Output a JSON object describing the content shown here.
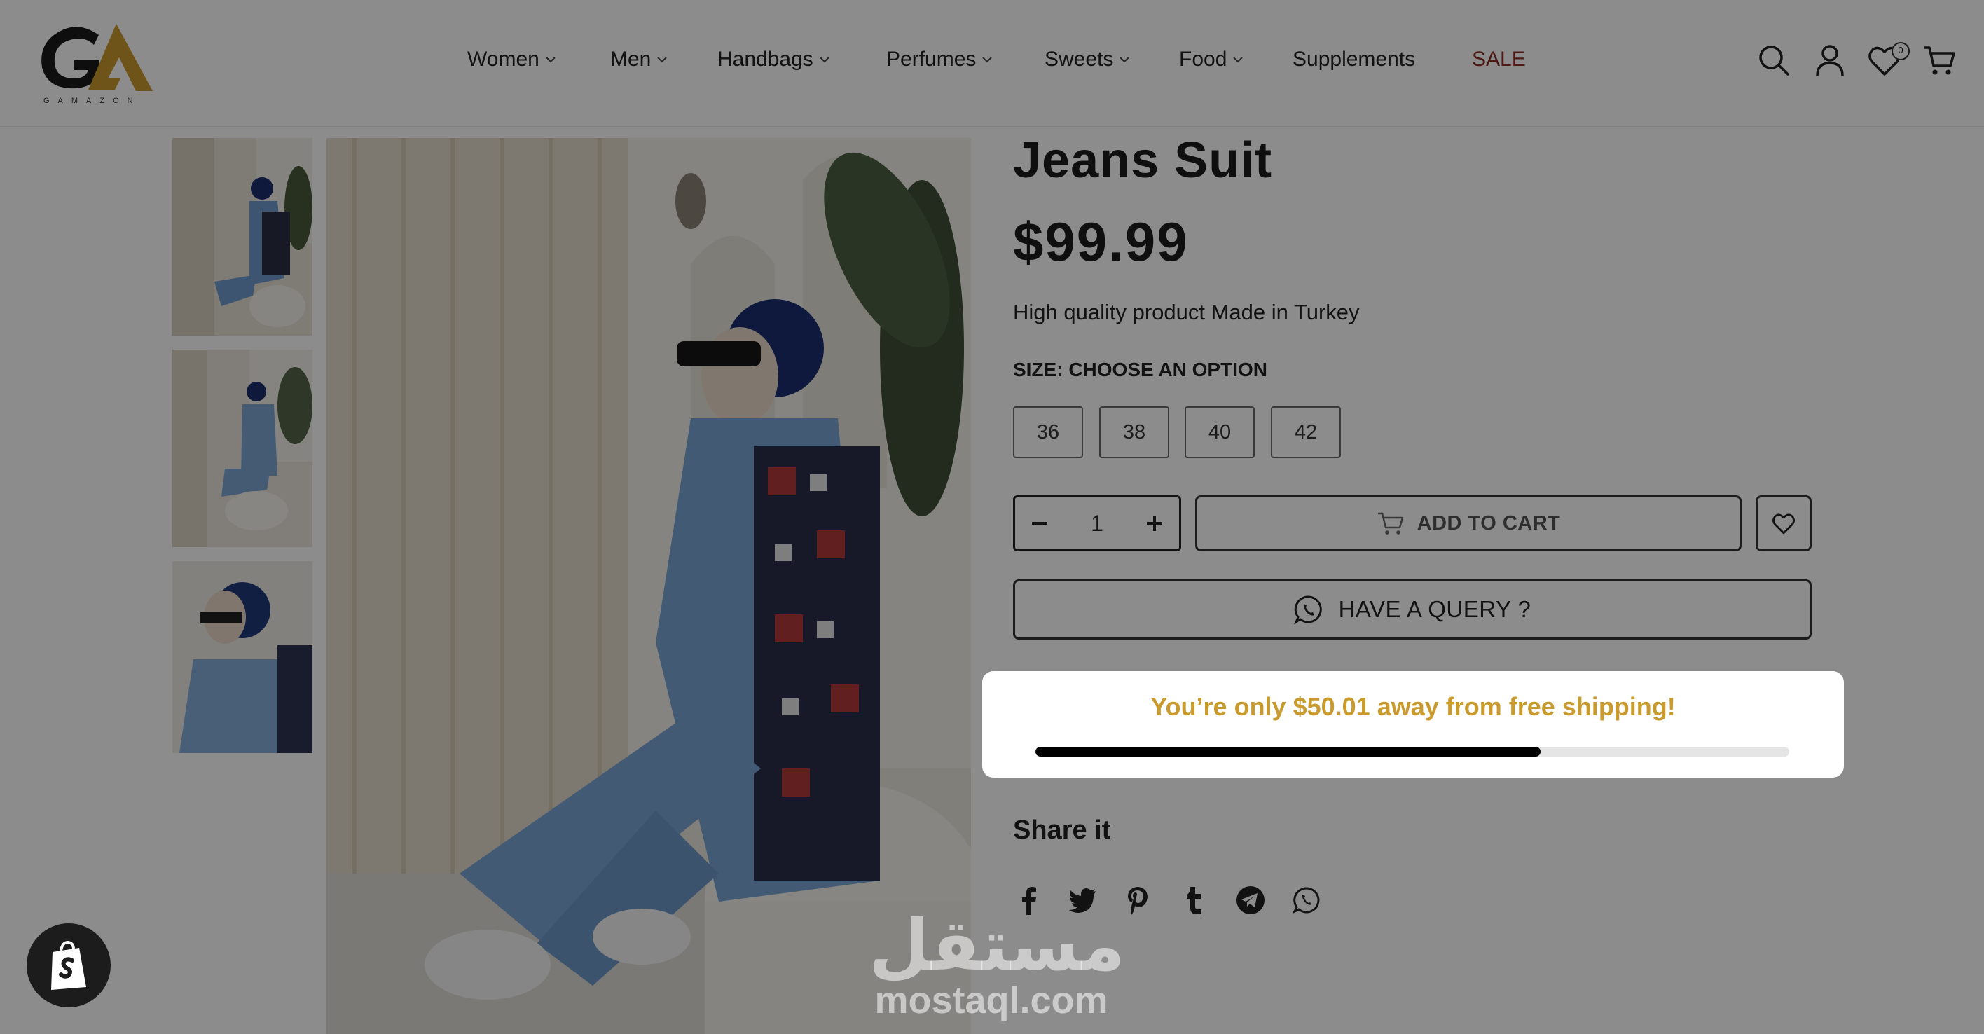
{
  "brand": {
    "name": "GA",
    "subtitle": "GAMAZON",
    "colors": {
      "dark": "#1a1a1a",
      "gold": "#c99a2e"
    }
  },
  "nav": {
    "items": [
      {
        "label": "Women",
        "dropdown": true
      },
      {
        "label": "Men",
        "dropdown": true
      },
      {
        "label": "Handbags",
        "dropdown": true
      },
      {
        "label": "Perfumes",
        "dropdown": true
      },
      {
        "label": "Sweets",
        "dropdown": true
      },
      {
        "label": "Food",
        "dropdown": true
      },
      {
        "label": "Supplements",
        "dropdown": false
      },
      {
        "label": "SALE",
        "dropdown": false
      }
    ],
    "sale_color": "#8b2e25"
  },
  "header_icons": {
    "search": "search-icon",
    "account": "user-icon",
    "wishlist": "heart-icon",
    "wishlist_count": "0",
    "cart": "cart-icon"
  },
  "product": {
    "title": "Jeans Suit",
    "price": "$99.99",
    "description": "High quality product Made in Turkey",
    "size_label": "SIZE: CHOOSE AN OPTION",
    "sizes": [
      "36",
      "38",
      "40",
      "42"
    ],
    "quantity": "1",
    "add_to_cart": "ADD TO CART",
    "query": "HAVE A QUERY ?"
  },
  "share": {
    "title": "Share it",
    "networks": [
      "facebook-icon",
      "twitter-icon",
      "pinterest-icon",
      "tumblr-icon",
      "telegram-icon",
      "whatsapp-icon"
    ]
  },
  "shipping_popup": {
    "message": "You’re only $50.01 away from free shipping!",
    "progress": 0.67,
    "text_color": "#c99a2e"
  },
  "watermark": {
    "arabic": "مستقل",
    "latin": "mostaql.com"
  }
}
